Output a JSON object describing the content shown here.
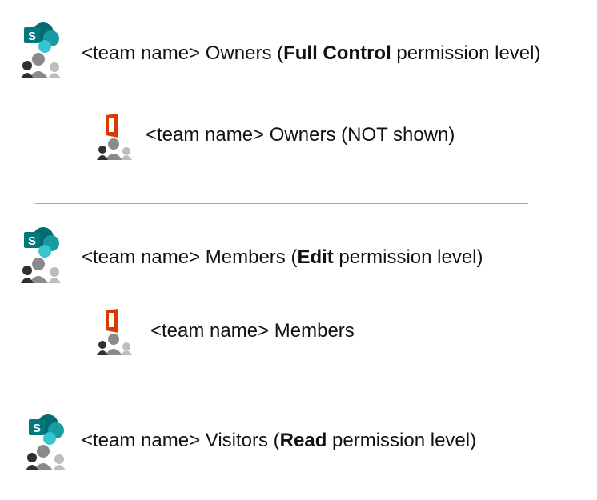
{
  "rows": [
    {
      "prefix": "<team name> Owners (",
      "bold": "Full Control",
      "suffix": " permission level)",
      "icon": "sharepoint-group-icon"
    },
    {
      "prefix": "<team name> Owners (NOT shown)",
      "bold": "",
      "suffix": "",
      "icon": "office-group-icon"
    },
    {
      "prefix": "<team name> Members (",
      "bold": "Edit",
      "suffix": " permission level)",
      "icon": "sharepoint-group-icon"
    },
    {
      "prefix": "<team name> Members",
      "bold": "",
      "suffix": "",
      "icon": "office-group-icon"
    },
    {
      "prefix": "<team name> Visitors (",
      "bold": "Read",
      "suffix": " permission level)",
      "icon": "sharepoint-group-icon"
    }
  ],
  "colors": {
    "sharepoint_dark": "#036c70",
    "sharepoint_mid": "#1a9ba1",
    "sharepoint_light": "#37c6d0",
    "office_red": "#d83b01",
    "people_dark": "#303030",
    "people_mid": "#8a8a8a",
    "people_light": "#bdbdbd",
    "divider": "#a6a6a6"
  }
}
